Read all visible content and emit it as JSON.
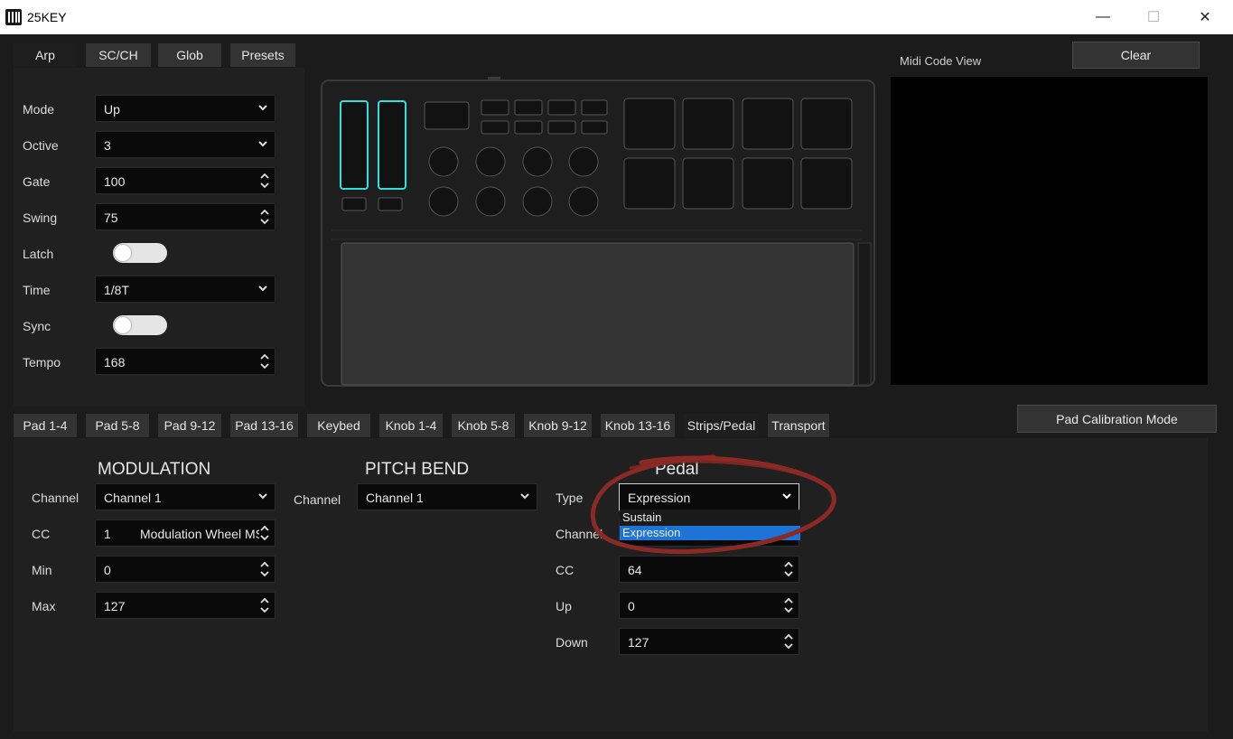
{
  "window": {
    "title": "25KEY",
    "minimize": "—",
    "maximize": "☐",
    "close": "✕"
  },
  "top_tabs": [
    "Arp",
    "SC/CH",
    "Glob",
    "Presets"
  ],
  "arp": {
    "mode": {
      "label": "Mode",
      "value": "Up"
    },
    "octave": {
      "label": "Octive",
      "value": "3"
    },
    "gate": {
      "label": "Gate",
      "value": "100"
    },
    "swing": {
      "label": "Swing",
      "value": "75"
    },
    "latch": {
      "label": "Latch",
      "on": false
    },
    "time": {
      "label": "Time",
      "value": "1/8T"
    },
    "sync": {
      "label": "Sync",
      "on": false
    },
    "tempo": {
      "label": "Tempo",
      "value": "168"
    }
  },
  "midi": {
    "label": "Midi Code View",
    "clear_button": "Clear"
  },
  "pad_calibration_button": "Pad Calibration Mode",
  "bottom_tabs": [
    "Pad 1-4",
    "Pad 5-8",
    "Pad 9-12",
    "Pad 13-16",
    "Keybed",
    "Knob 1-4",
    "Knob 5-8",
    "Knob 9-12",
    "Knob 13-16",
    "Strips/Pedal",
    "Transport"
  ],
  "modulation": {
    "title": "MODULATION",
    "channel": {
      "label": "Channel",
      "value": "Channel 1"
    },
    "cc": {
      "label": "CC",
      "value": "1",
      "name": "Modulation Wheel MS"
    },
    "min": {
      "label": "Min",
      "value": "0"
    },
    "max": {
      "label": "Max",
      "value": "127"
    }
  },
  "pitch_bend": {
    "title": "PITCH BEND",
    "channel": {
      "label": "Channel",
      "value": "Channel 1"
    }
  },
  "pedal": {
    "title": "Pedal",
    "type": {
      "label": "Type",
      "value": "Expression",
      "options": [
        "Sustain",
        "Expression"
      ]
    },
    "channel": {
      "label": "Channel"
    },
    "cc": {
      "label": "CC",
      "value": "64"
    },
    "up": {
      "label": "Up",
      "value": "0"
    },
    "down": {
      "label": "Down",
      "value": "127"
    }
  },
  "colors": {
    "highlight": "#1e74d6",
    "annotation": "#8b2a24",
    "accent_cyan": "#2fe0e0"
  }
}
